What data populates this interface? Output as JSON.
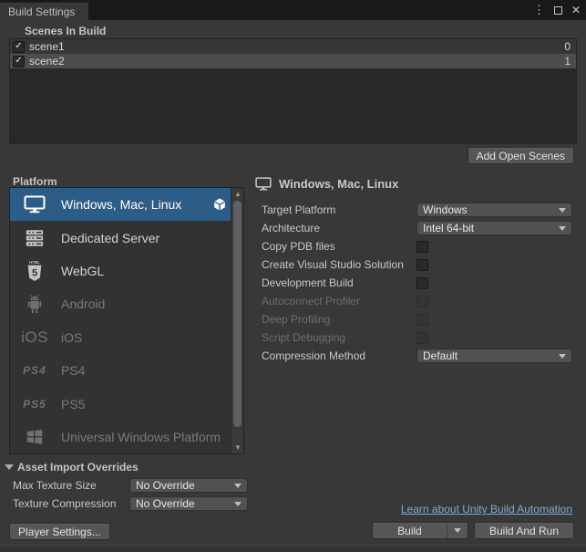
{
  "window": {
    "title": "Build Settings",
    "controls": {
      "menu": "⋮",
      "close": "✕"
    }
  },
  "colors": {
    "background": "#383838",
    "titlebar": "#191919",
    "selection_blue": "#2c5d87",
    "link_blue": "#86a8ce",
    "scene_selected_row": "#4d4d4d"
  },
  "scenes": {
    "header": "Scenes In Build",
    "items": [
      {
        "name": "scene1",
        "index": "0",
        "checked": true
      },
      {
        "name": "scene2",
        "index": "1",
        "checked": true
      }
    ],
    "add_button": "Add Open Scenes"
  },
  "platform": {
    "header": "Platform",
    "items": [
      {
        "label": "Windows, Mac, Linux",
        "icon": "monitor-icon",
        "selected": true,
        "enabled": true,
        "badge": "unity-logo-icon"
      },
      {
        "label": "Dedicated Server",
        "icon": "server-icon",
        "selected": false,
        "enabled": true
      },
      {
        "label": "WebGL",
        "icon": "html5-icon",
        "selected": false,
        "enabled": true
      },
      {
        "label": "Android",
        "icon": "android-icon",
        "selected": false,
        "enabled": false
      },
      {
        "label": "iOS",
        "icon": "ios-logo-icon",
        "icon_text": "iOS",
        "selected": false,
        "enabled": false
      },
      {
        "label": "PS4",
        "icon": "ps4-logo-icon",
        "icon_text": "PS4",
        "selected": false,
        "enabled": false
      },
      {
        "label": "PS5",
        "icon": "ps5-logo-icon",
        "icon_text": "PS5",
        "selected": false,
        "enabled": false
      },
      {
        "label": "Universal Windows Platform",
        "icon": "windows-icon",
        "selected": false,
        "enabled": false
      }
    ]
  },
  "settings": {
    "header": "Windows, Mac, Linux",
    "header_icon": "monitor-icon",
    "rows": [
      {
        "label": "Target Platform",
        "type": "dropdown",
        "value": "Windows",
        "enabled": true
      },
      {
        "label": "Architecture",
        "type": "dropdown",
        "value": "Intel 64-bit",
        "enabled": true
      },
      {
        "label": "Copy PDB files",
        "type": "checkbox",
        "checked": false,
        "enabled": true
      },
      {
        "label": "Create Visual Studio Solution",
        "type": "checkbox",
        "checked": false,
        "enabled": true
      },
      {
        "label": "Development Build",
        "type": "checkbox",
        "checked": false,
        "enabled": true
      },
      {
        "label": "Autoconnect Profiler",
        "type": "checkbox",
        "checked": false,
        "enabled": false
      },
      {
        "label": "Deep Profiling",
        "type": "checkbox",
        "checked": false,
        "enabled": false
      },
      {
        "label": "Script Debugging",
        "type": "checkbox",
        "checked": false,
        "enabled": false
      },
      {
        "label": "Compression Method",
        "type": "dropdown",
        "value": "Default",
        "enabled": true
      }
    ]
  },
  "overrides": {
    "header": "Asset Import Overrides",
    "rows": [
      {
        "label": "Max Texture Size",
        "value": "No Override"
      },
      {
        "label": "Texture Compression",
        "value": "No Override"
      }
    ]
  },
  "footer": {
    "player_settings": "Player Settings...",
    "link": "Learn about Unity Build Automation",
    "build": "Build",
    "build_and_run": "Build And Run"
  }
}
